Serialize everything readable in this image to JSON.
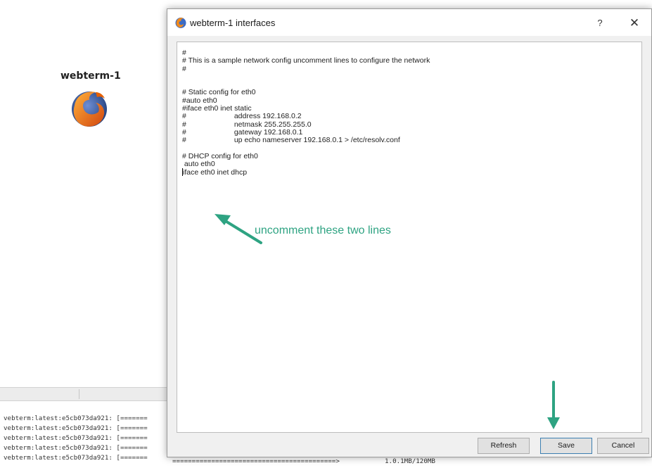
{
  "workspace": {
    "node_label": "webterm-1",
    "console_lines": [
      "vebterm:latest:e5cb073da921: [=======",
      "vebterm:latest:e5cb073da921: [=======",
      "vebterm:latest:e5cb073da921: [=======",
      "vebterm:latest:e5cb073da921: [=======",
      "vebterm:latest:e5cb073da921: [======="
    ],
    "bottom_progress": "==========================================>",
    "bottom_size": "1.0.1MB/120MB"
  },
  "dialog": {
    "title": "webterm-1 interfaces",
    "help_label": "?",
    "close_label": "✕",
    "editor_lines": [
      "#",
      "# This is a sample network config uncomment lines to configure the network",
      "#",
      "",
      "",
      "# Static config for eth0",
      "#auto eth0",
      "#iface eth0 inet static",
      "#\taddress 192.168.0.2",
      "#\tnetmask 255.255.255.0",
      "#\tgateway 192.168.0.1",
      "#\tup echo nameserver 192.168.0.1 > /etc/resolv.conf",
      "",
      "# DHCP config for eth0",
      " auto eth0",
      "iface eth0 inet dhcp"
    ],
    "annotation": "uncomment these two lines",
    "buttons": {
      "refresh": "Refresh",
      "save": "Save",
      "cancel": "Cancel"
    }
  },
  "colors": {
    "annotation_accent": "#2ea382",
    "firefox_orange": "#e66000",
    "firefox_blue": "#2a4b8d"
  },
  "icons": {
    "node": "firefox-icon",
    "title": "browser-icon",
    "annotation_arrows": "arrow-icon"
  }
}
